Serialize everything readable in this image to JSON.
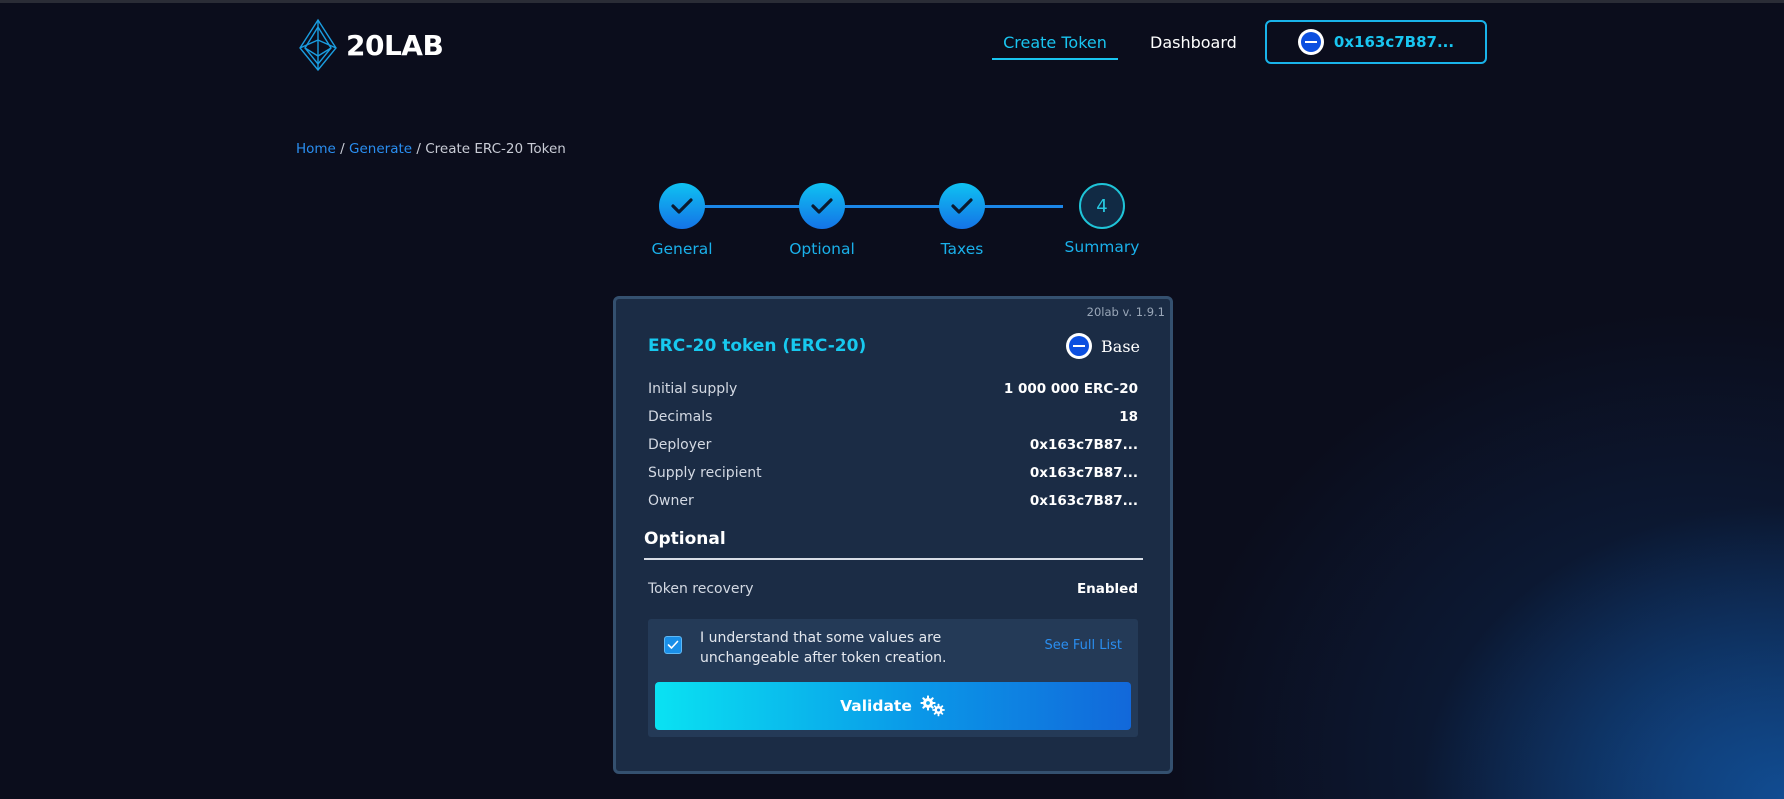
{
  "header": {
    "logo_text": "20LAB",
    "nav": {
      "create_token": "Create Token",
      "dashboard": "Dashboard"
    },
    "wallet_address": "0x163c7B87..."
  },
  "breadcrumb": {
    "home": "Home",
    "sep": "/",
    "generate": "Generate",
    "current": "Create ERC-20 Token"
  },
  "stepper": {
    "steps": [
      {
        "label": "General",
        "status": "complete"
      },
      {
        "label": "Optional",
        "status": "complete"
      },
      {
        "label": "Taxes",
        "status": "complete"
      },
      {
        "label": "Summary",
        "status": "active",
        "number": "4"
      }
    ]
  },
  "summary": {
    "version": "20lab v. 1.9.1",
    "title": "ERC-20 token (ERC-20)",
    "network": "Base",
    "rows": [
      {
        "label": "Initial supply",
        "value": "1 000 000 ERC-20"
      },
      {
        "label": "Decimals",
        "value": "18"
      },
      {
        "label": "Deployer",
        "value": "0x163c7B87..."
      },
      {
        "label": "Supply recipient",
        "value": "0x163c7B87..."
      },
      {
        "label": "Owner",
        "value": "0x163c7B87..."
      }
    ],
    "optional_title": "Optional",
    "optional_rows": [
      {
        "label": "Token recovery",
        "value": "Enabled"
      }
    ]
  },
  "confirm": {
    "checked": true,
    "text": "I understand that some values are unchangeable after token creation.",
    "see_full_list": "See Full List"
  },
  "validate_label": "Validate",
  "colors": {
    "accent": "#19c5f0",
    "link": "#2a8ef0",
    "card": "#1b2c45",
    "background": "#0b0d1c"
  }
}
